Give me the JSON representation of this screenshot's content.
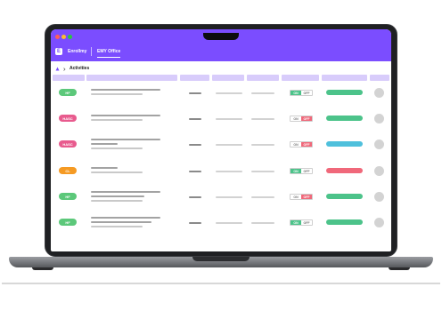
{
  "window": {
    "dots": [
      "#ff5f57",
      "#febc2e",
      "#28c840"
    ]
  },
  "app": {
    "logo_glyph": "E",
    "title": "Enrollmy",
    "tab_label": "EMY Office",
    "accent": "#7b4dff"
  },
  "breadcrumb": {
    "icon": "dropdown-icon",
    "title": "Activities"
  },
  "toggle": {
    "on_label": "ON",
    "off_label": "OFF"
  },
  "rows": [
    {
      "badge": "HF",
      "badge_color": "#5cc87a",
      "toggle_state": "on",
      "pill_color": "#4cc38a"
    },
    {
      "badge": "HASC",
      "badge_color": "#e85b8e",
      "toggle_state": "off",
      "pill_color": "#4cc38a"
    },
    {
      "badge": "HASC",
      "badge_color": "#e85b8e",
      "toggle_state": "off",
      "pill_color": "#4fc0dc"
    },
    {
      "badge": "CL",
      "badge_color": "#f59a23",
      "toggle_state": "on",
      "pill_color": "#f0687a"
    },
    {
      "badge": "HF",
      "badge_color": "#5cc87a",
      "toggle_state": "off",
      "pill_color": "#4cc38a"
    },
    {
      "badge": "HF",
      "badge_color": "#5cc87a",
      "toggle_state": "on",
      "pill_color": "#4cc38a"
    }
  ]
}
